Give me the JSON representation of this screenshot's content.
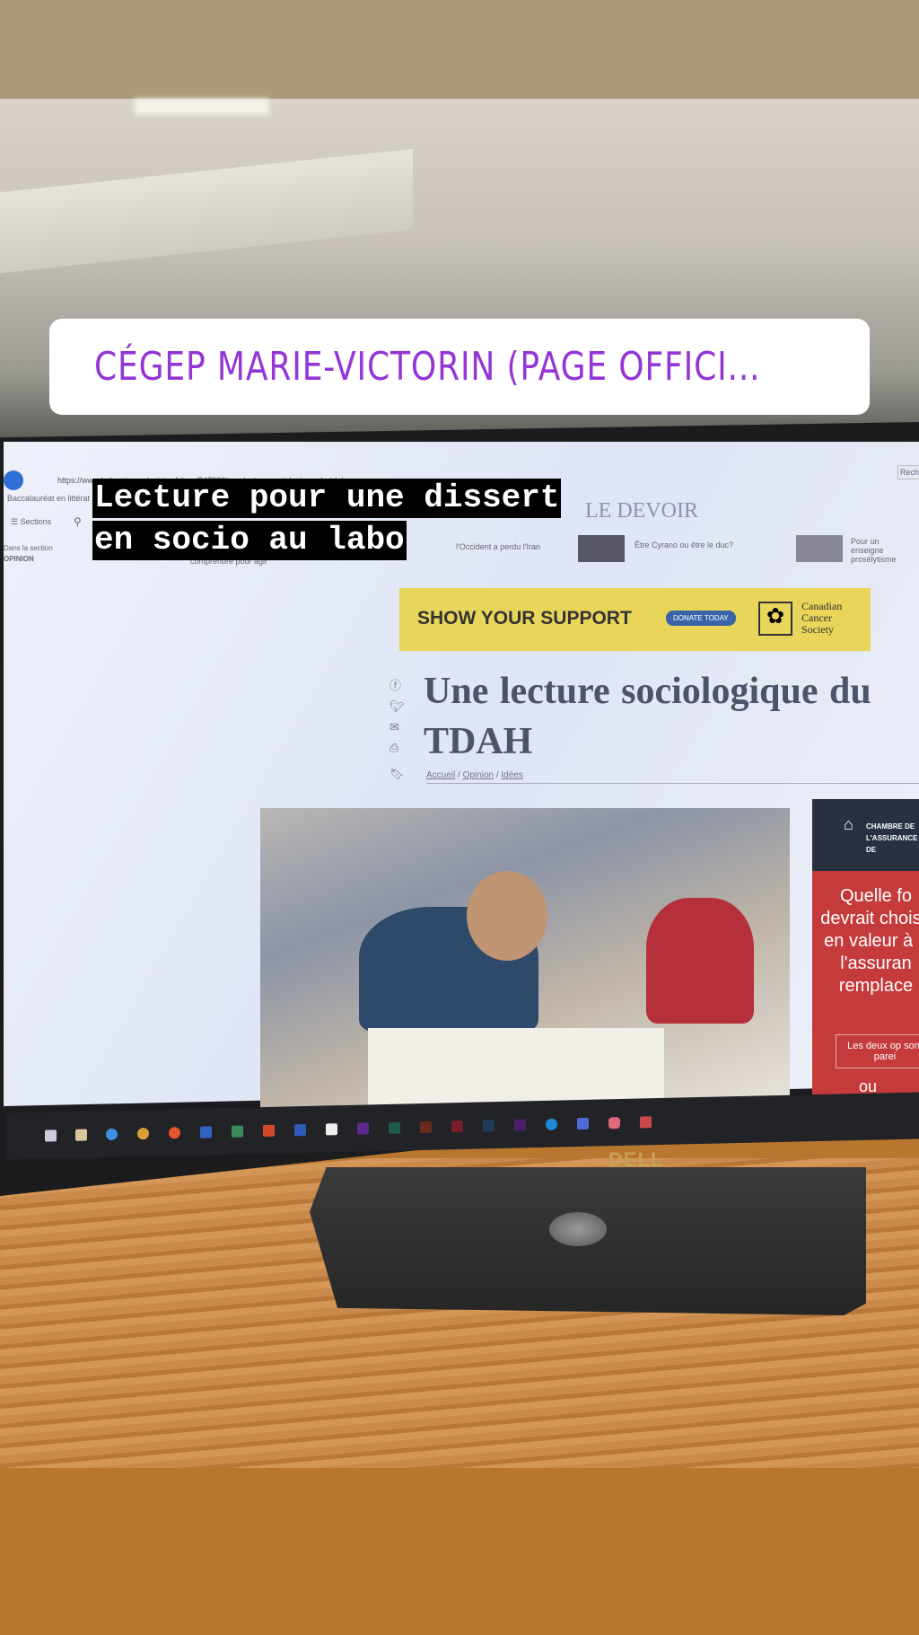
{
  "story": {
    "location_sticker": "CÉGEP MARIE-VICTORIN (PAGE OFFICI...",
    "caption_lines": [
      "Lecture pour une dissert",
      "en socio au labo"
    ]
  },
  "browser": {
    "url": "https://www.ledevoir.com/opinion/idees/547932/une-lecture-sociologique-du-tdah",
    "tab": "Baccalauréat en littérat",
    "search_placeholder": "Reche"
  },
  "site": {
    "logo": "LE DEVOIR",
    "sections_label": "Sections",
    "in_section_label": "Dans la section",
    "section_name": "OPINION",
    "headlines": [
      "comprendre pour agir",
      "l'Occident a perdu l'Iran",
      "Être Cyrano ou être le duc?",
      "Pour un enseigne prosélytisme"
    ],
    "ad": {
      "headline": "SHOW YOUR SUPPORT",
      "button": "DONATE TODAY",
      "sponsor": "Canadian Cancer Society"
    },
    "article_title": "Une lecture sociologique du TDAH",
    "breadcrumb": [
      "Accueil",
      "Opinion",
      "Idées"
    ],
    "side_ad": {
      "org": "CHAMBRE DE L'ASSURANCE DE DOMMAGES",
      "question": "Quelle fo devrait choisir en valeur à n l'assuran remplace",
      "option": "Les deux op sont parei",
      "or": "ou"
    }
  },
  "monitor": {
    "brand": "DELL"
  },
  "colors": {
    "sticker_text": "#9436d6",
    "ad_yellow": "#e9d55a",
    "side_ad_red": "#c53a3a"
  }
}
